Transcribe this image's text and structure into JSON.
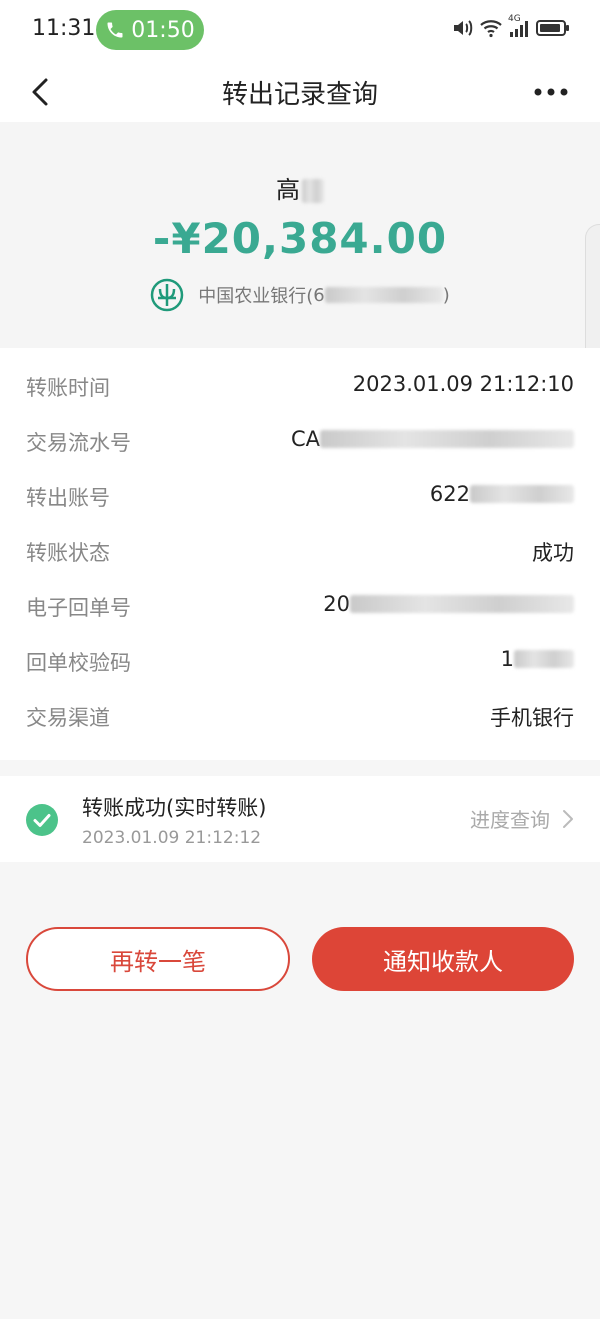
{
  "status_bar": {
    "time": "11:31",
    "call_timer": "01:50",
    "network_label": "4G"
  },
  "nav": {
    "title": "转出记录查询"
  },
  "summary": {
    "payee_surname": "高",
    "amount": "-¥20,384.00",
    "bank_prefix": "中国农业银行(",
    "bank_account_visible": "6",
    "bank_suffix": ")"
  },
  "details": [
    {
      "label": "转账时间",
      "value": "2023.01.09 21:12:10",
      "blurred": false
    },
    {
      "label": "交易流水号",
      "value": "CA",
      "blurred": true
    },
    {
      "label": "转出账号",
      "value": "622",
      "blurred": true
    },
    {
      "label": "转账状态",
      "value": "成功",
      "blurred": false
    },
    {
      "label": "电子回单号",
      "value": "20",
      "blurred": true
    },
    {
      "label": "回单校验码",
      "value": "1",
      "blurred": true
    },
    {
      "label": "交易渠道",
      "value": "手机银行",
      "blurred": false
    }
  ],
  "status_card": {
    "title": "转账成功(实时转账)",
    "time": "2023.01.09 21:12:12",
    "link_label": "进度查询"
  },
  "buttons": {
    "again_label": "再转一笔",
    "notify_label": "通知收款人"
  },
  "colors": {
    "amount": "#3aa992",
    "primary_red": "#dd4537",
    "call_green": "#6cc167",
    "check_green": "#4cc38a"
  }
}
